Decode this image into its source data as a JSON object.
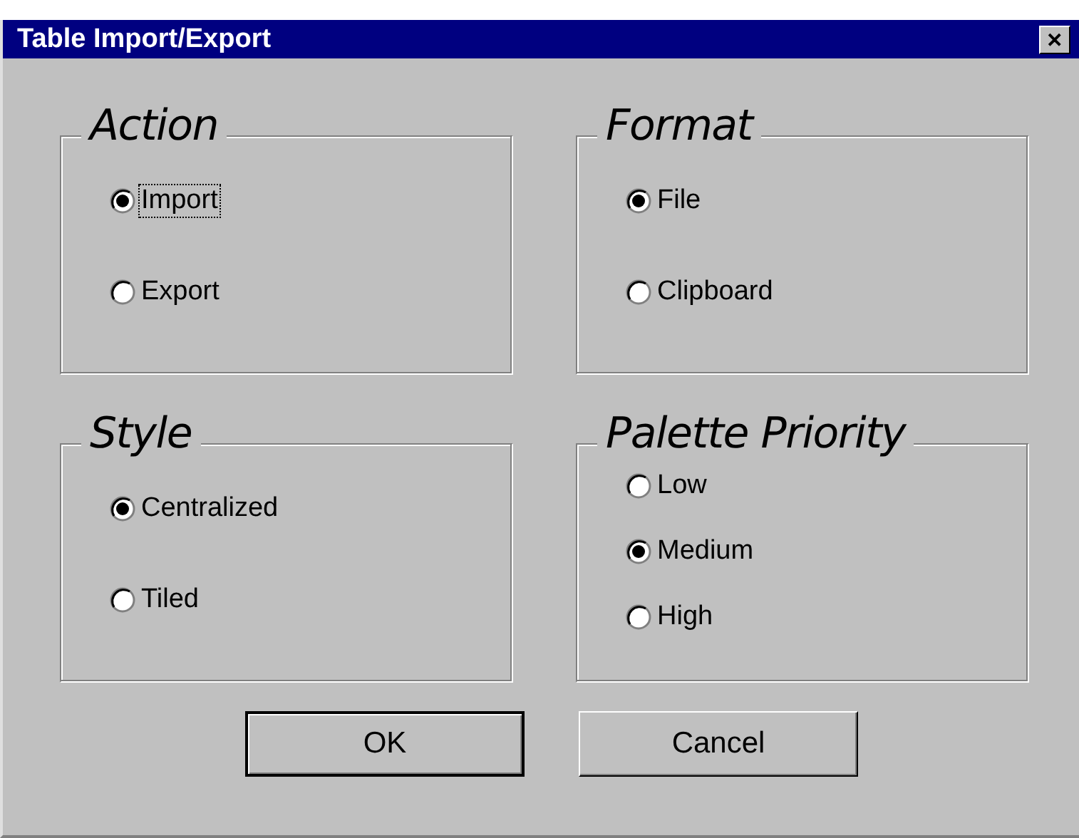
{
  "window": {
    "title": "Table Import/Export",
    "close_label": "✕"
  },
  "groups": [
    {
      "title": "Action",
      "options": [
        {
          "label": "Import",
          "selected": true,
          "focused": true
        },
        {
          "label": "Export",
          "selected": false,
          "focused": false
        }
      ]
    },
    {
      "title": "Format",
      "options": [
        {
          "label": "File",
          "selected": true,
          "focused": false
        },
        {
          "label": "Clipboard",
          "selected": false,
          "focused": false
        }
      ]
    },
    {
      "title": "Style",
      "options": [
        {
          "label": "Centralized",
          "selected": true,
          "focused": false
        },
        {
          "label": "Tiled",
          "selected": false,
          "focused": false
        }
      ]
    },
    {
      "title": "Palette Priority",
      "options": [
        {
          "label": "Low",
          "selected": false,
          "focused": false
        },
        {
          "label": "Medium",
          "selected": true,
          "focused": false
        },
        {
          "label": "High",
          "selected": false,
          "focused": false
        }
      ]
    }
  ],
  "buttons": [
    {
      "label": "OK",
      "default": true
    },
    {
      "label": "Cancel",
      "default": false
    }
  ]
}
